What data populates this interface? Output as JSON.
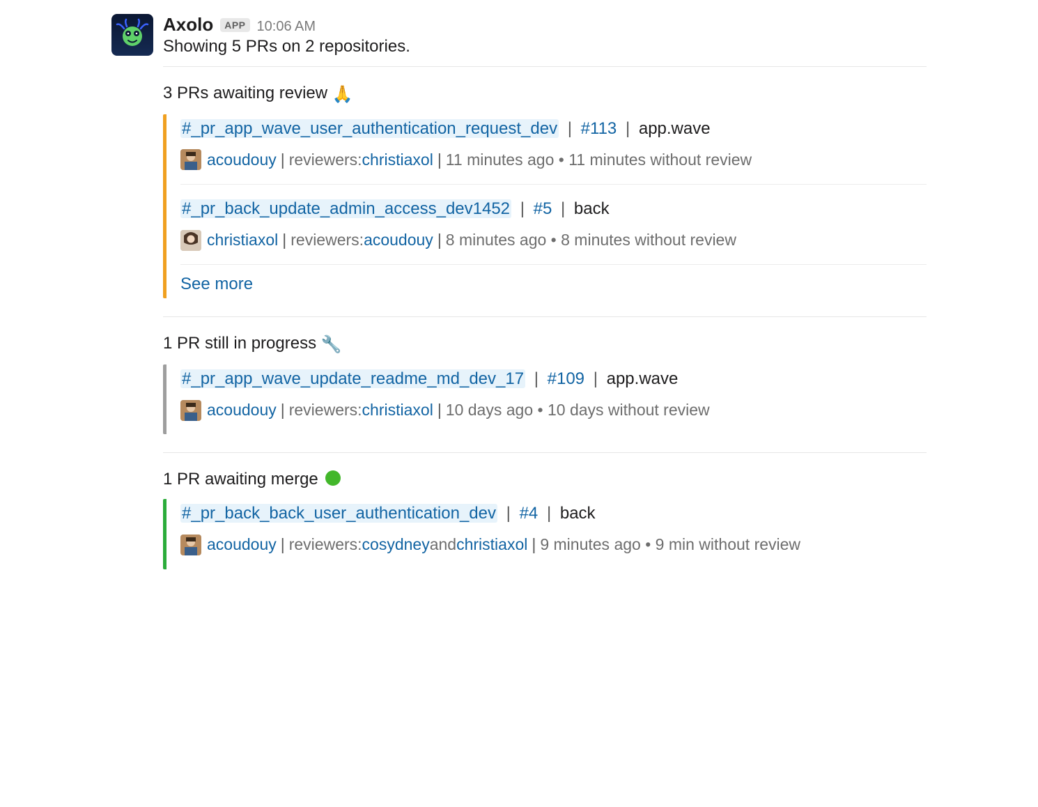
{
  "app": {
    "name": "Axolo",
    "badge": "APP",
    "time": "10:06 AM",
    "summary": "Showing 5 PRs on 2 repositories."
  },
  "sections": {
    "awaiting_review": {
      "title": "3 PRs awaiting review ",
      "emoji": "🙏",
      "prs": [
        {
          "channel": "#_pr_app_wave_user_authentication_request_dev",
          "pr_num": "#113",
          "repo": "app.wave",
          "author": "acoudouy",
          "reviewers_label": "reviewers: ",
          "reviewers": [
            "christiaxol"
          ],
          "age": "11 minutes ago",
          "no_review": "11 minutes without review",
          "avatar": "m1"
        },
        {
          "channel": "#_pr_back_update_admin_access_dev1452",
          "pr_num": "#5",
          "repo": "back",
          "author": "christiaxol",
          "reviewers_label": "reviewers: ",
          "reviewers": [
            "acoudouy"
          ],
          "age": "8 minutes ago",
          "no_review": "8 minutes without review",
          "avatar": "f1"
        }
      ],
      "see_more": "See more"
    },
    "in_progress": {
      "title": "1 PR still in progress ",
      "emoji": "🔧",
      "prs": [
        {
          "channel": "#_pr_app_wave_update_readme_md_dev_17",
          "pr_num": "#109",
          "repo": "app.wave",
          "author": "acoudouy",
          "reviewers_label": "reviewers: ",
          "reviewers": [
            "christiaxol"
          ],
          "age": "10 days ago",
          "no_review": "10 days without review",
          "avatar": "m1"
        }
      ]
    },
    "awaiting_merge": {
      "title": "1 PR awaiting merge ",
      "prs": [
        {
          "channel": "#_pr_back_back_user_authentication_dev",
          "pr_num": "#4",
          "repo": "back",
          "author": "acoudouy",
          "reviewers_label": "reviewers: ",
          "reviewers_join": " and ",
          "reviewers": [
            "cosydney",
            "christiaxol"
          ],
          "age": "9 minutes ago",
          "no_review": "9 min without review",
          "avatar": "m1"
        }
      ]
    }
  }
}
